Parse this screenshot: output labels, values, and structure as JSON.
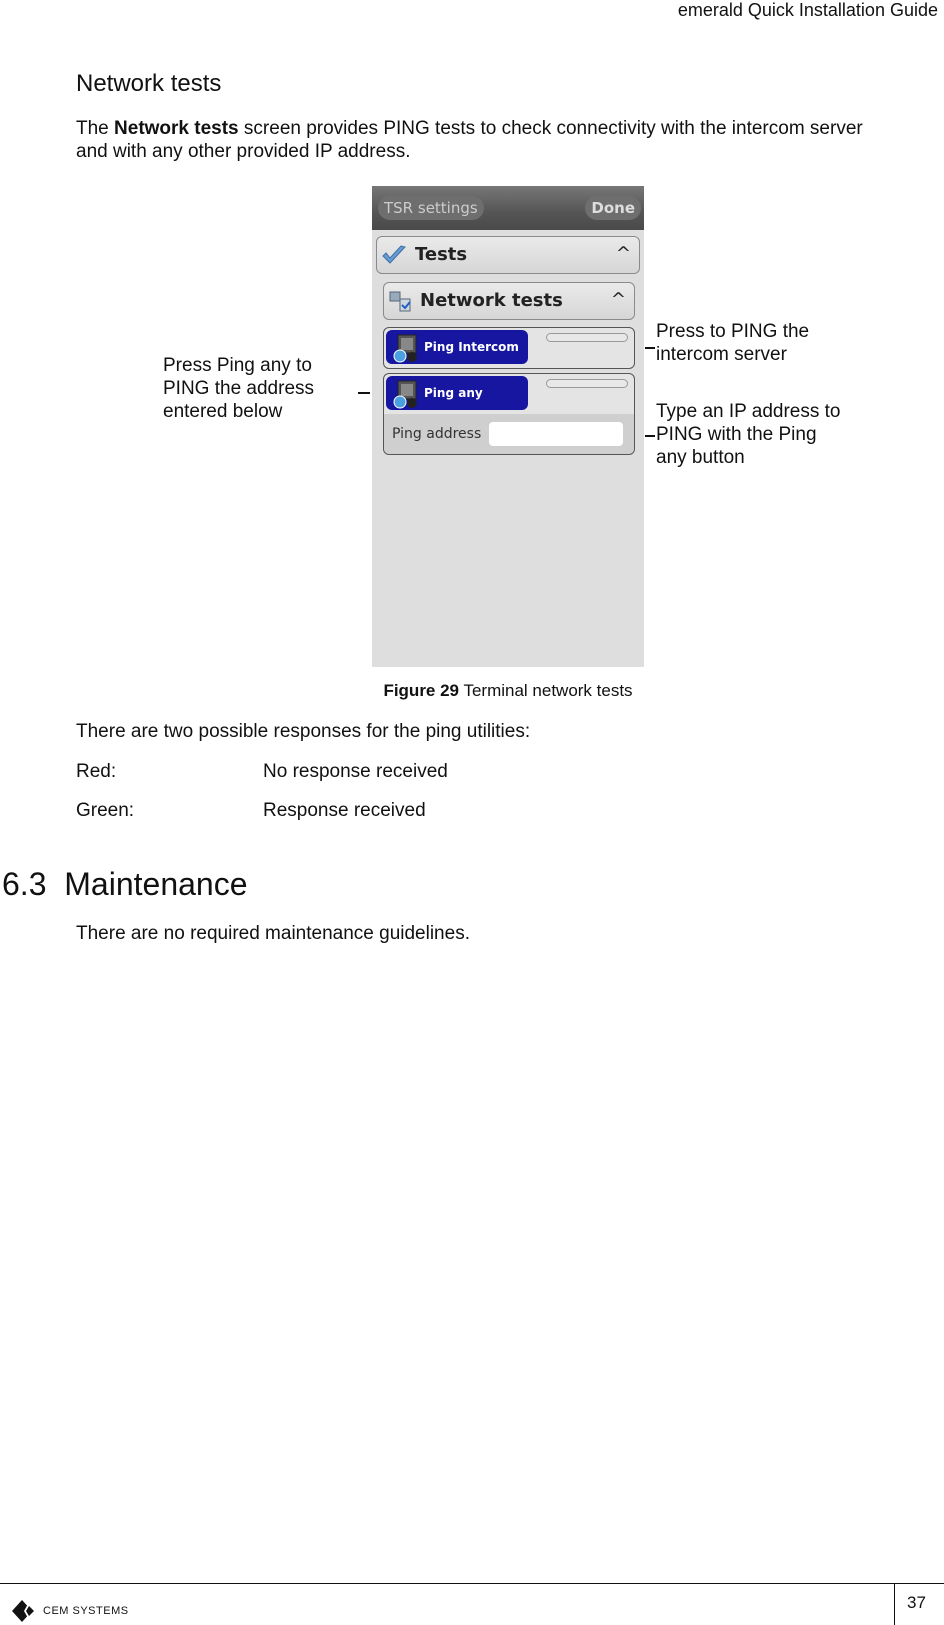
{
  "header": {
    "title": "emerald Quick Installation Guide"
  },
  "section": {
    "heading": "Network tests",
    "intro_pre": "The ",
    "intro_bold": "Network tests",
    "intro_post": " screen provides PING tests to check connectivity with the intercom server",
    "intro_line2": "and with any other provided IP address."
  },
  "screenshot": {
    "topbar": {
      "back_label": "TSR settings",
      "done_label": "Done"
    },
    "tests_section": {
      "label": "Tests",
      "chevron": "^",
      "icon": "checkmark-icon"
    },
    "network_section": {
      "label": "Network tests",
      "chevron": "^",
      "icon": "network-icon"
    },
    "ping_intercom": {
      "label": "Ping Intercom",
      "icon": "computer-icon"
    },
    "ping_any": {
      "label": "Ping any",
      "icon": "computer-icon"
    },
    "ping_address": {
      "label": "Ping address",
      "value": ""
    }
  },
  "annotations": {
    "left": [
      "Press Ping any to",
      "PING the address",
      "entered below"
    ],
    "right_top": [
      "Press to PING the",
      "intercom server"
    ],
    "right_bottom": [
      "Type an IP address to",
      "PING with the Ping",
      "any button"
    ]
  },
  "figure": {
    "number": "Figure 29",
    "caption": " Terminal network tests"
  },
  "responses": {
    "intro": "There are two possible responses for the ping utilities:",
    "items": [
      {
        "key": "Red:",
        "value": "No response received"
      },
      {
        "key": "Green:",
        "value": "Response received"
      }
    ]
  },
  "maintenance": {
    "heading": "6.3  Maintenance",
    "text": "There are no required maintenance guidelines."
  },
  "footer": {
    "brand": "CEM SYSTEMS",
    "page_number": "37"
  }
}
